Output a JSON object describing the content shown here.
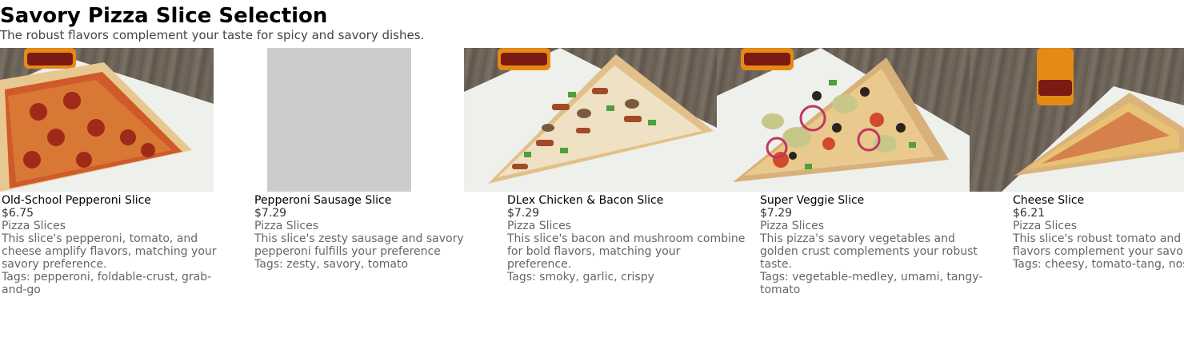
{
  "page": {
    "title": "Savory Pizza Slice Selection",
    "subtitle": "The robust flavors complement your taste for spicy and savory dishes."
  },
  "products": [
    {
      "name": "Old-School Pepperoni Slice",
      "price": "$6.75",
      "category": "Pizza Slices",
      "description": "This slice's pepperoni, tomato, and cheese amplify flavors, matching your savory preference.",
      "tags": "Tags: pepperoni, foldable-crust, grab-and-go"
    },
    {
      "name": "Pepperoni Sausage Slice",
      "price": "$7.29",
      "category": "Pizza Slices",
      "description": "This slice's zesty sausage and savory pepperoni fulfills your preference",
      "tags": "Tags: zesty, savory, tomato"
    },
    {
      "name": "DLex Chicken & Bacon Slice",
      "price": "$7.29",
      "category": "Pizza Slices",
      "description": "This slice's bacon and mushroom combine for bold flavors, matching your preference.",
      "tags": "Tags: smoky, garlic, crispy"
    },
    {
      "name": "Super Veggie Slice",
      "price": "$7.29",
      "category": "Pizza Slices",
      "description": "This pizza's savory vegetables and golden crust complements your robust taste.",
      "tags": "Tags: vegetable-medley, umami, tangy-tomato"
    },
    {
      "name": "Cheese Slice",
      "price": "$6.21",
      "category": "Pizza Slices",
      "description": "This slice's robust tomato and flavors complement your savo",
      "tags": "Tags: cheesy, tomato-tang, nos"
    }
  ],
  "colors": {
    "title": "#000000",
    "subtitle": "#444444",
    "muted_text": "#666666",
    "placeholder": "#cccccc"
  }
}
